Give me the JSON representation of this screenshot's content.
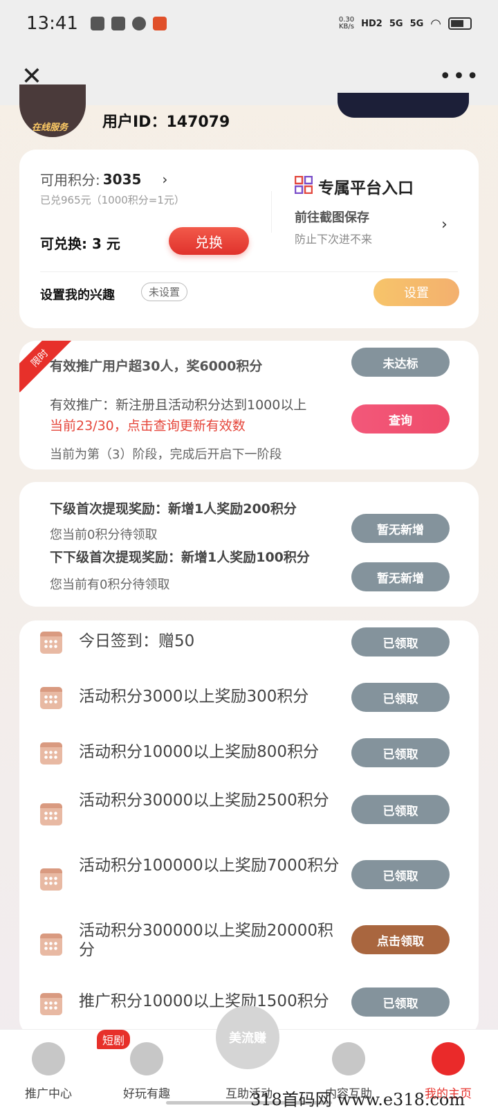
{
  "status_bar": {
    "time": "13:41",
    "net_speed_value": "0.30",
    "net_speed_unit": "KB/s",
    "hd_label": "HD2",
    "sig1": "5G",
    "sig2": "5G"
  },
  "user": {
    "avatar_label": "在线服务",
    "user_id": "用户ID：147079"
  },
  "points_card": {
    "points_label": "可用积分:",
    "points_value": "3035",
    "redeemed_note": "已兑965元（1000积分=1元）",
    "exchangeable": "可兑换: 3 元",
    "exchange_button": "兑换",
    "platform_title": "专属平台入口",
    "platform_sub1": "前往截图保存",
    "platform_sub2": "防止下次进不来",
    "interest_label": "设置我的兴趣",
    "interest_badge": "未设置",
    "set_button": "设置"
  },
  "promo_card": {
    "ribbon": "限时",
    "title": "有效推广用户超30人，奖6000积分",
    "line1": "有效推广：新注册且活动积分达到1000以上",
    "line2": "当前23/30，点击查询更新有效数",
    "line3": "当前为第（3）阶段，完成后开启下一阶段",
    "status_button": "未达标",
    "query_button": "查询"
  },
  "withdraw_card": {
    "title1": "下级首次提现奖励：新增1人奖励200积分",
    "line1": "您当前0积分待领取",
    "title2": "下下级首次提现奖励：新增1人奖励100积分",
    "line2": "您当前有0积分待领取",
    "button1": "暂无新增",
    "button2": "暂无新增"
  },
  "tasks": [
    {
      "text": "今日签到：赠50",
      "button": "已领取"
    },
    {
      "text": "活动积分3000以上奖励300积分",
      "button": "已领取"
    },
    {
      "text": "活动积分10000以上奖励800积分",
      "button": "已领取"
    },
    {
      "text": "活动积分30000以上奖励2500积分",
      "button": "已领取"
    },
    {
      "text": "活动积分100000以上奖励7000积分",
      "button": "已领取"
    },
    {
      "text": "活动积分300000以上奖励20000积分",
      "button": "点击领取"
    },
    {
      "text": "推广积分10000以上奖励1500积分",
      "button": "已领取"
    }
  ],
  "bottom_nav": {
    "items": [
      "推广中心",
      "好玩有趣",
      "互助活动",
      "内容互助",
      "我的主页"
    ],
    "badge": "短剧",
    "center_logo": "美流赚"
  },
  "watermark": "318首码网 www.e318.com",
  "colors": {
    "accent_red": "#e7302a",
    "gray_button": "#84939c",
    "claim_button": "#a9663f",
    "query_pink": "#ee4c6a"
  }
}
